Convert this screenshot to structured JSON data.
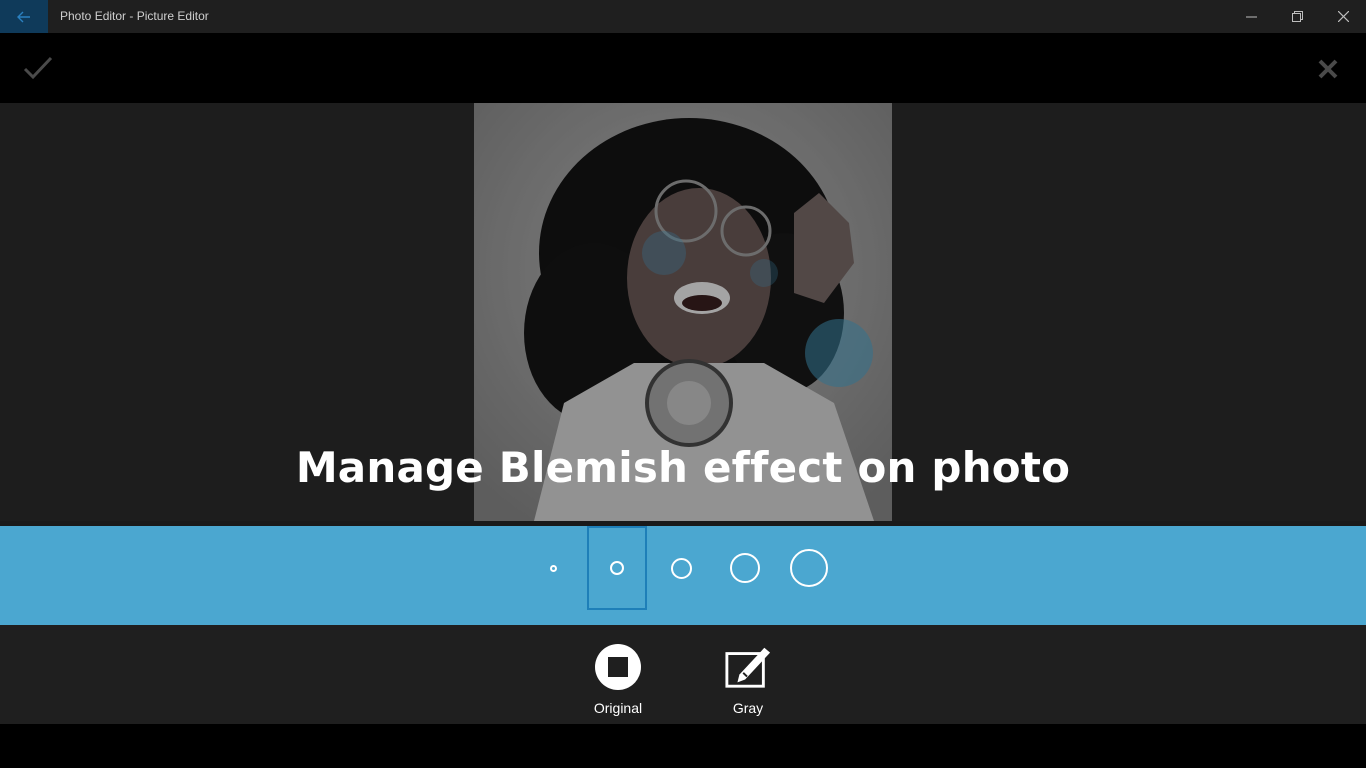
{
  "window": {
    "title": "Photo Editor - Picture Editor",
    "back_icon": "back-arrow-icon",
    "controls": [
      "minimize-icon",
      "maximize-icon",
      "close-icon"
    ]
  },
  "toolbar": {
    "apply_icon": "checkmark-icon",
    "cancel_icon": "close-x-icon"
  },
  "canvas": {
    "headline": "Manage Blemish effect on photo"
  },
  "brush_sizes": {
    "options": [
      "brush-size-1",
      "brush-size-2",
      "brush-size-3",
      "brush-size-4",
      "brush-size-5"
    ],
    "selected_index": 1
  },
  "tools": [
    {
      "label": "Original",
      "icon": "original-icon"
    },
    {
      "label": "Gray",
      "icon": "edit-pen-icon"
    }
  ],
  "colors": {
    "accent": "#4ba7d0",
    "selected_border": "#1e7fb8",
    "title_bar": "#1f1f1f"
  }
}
